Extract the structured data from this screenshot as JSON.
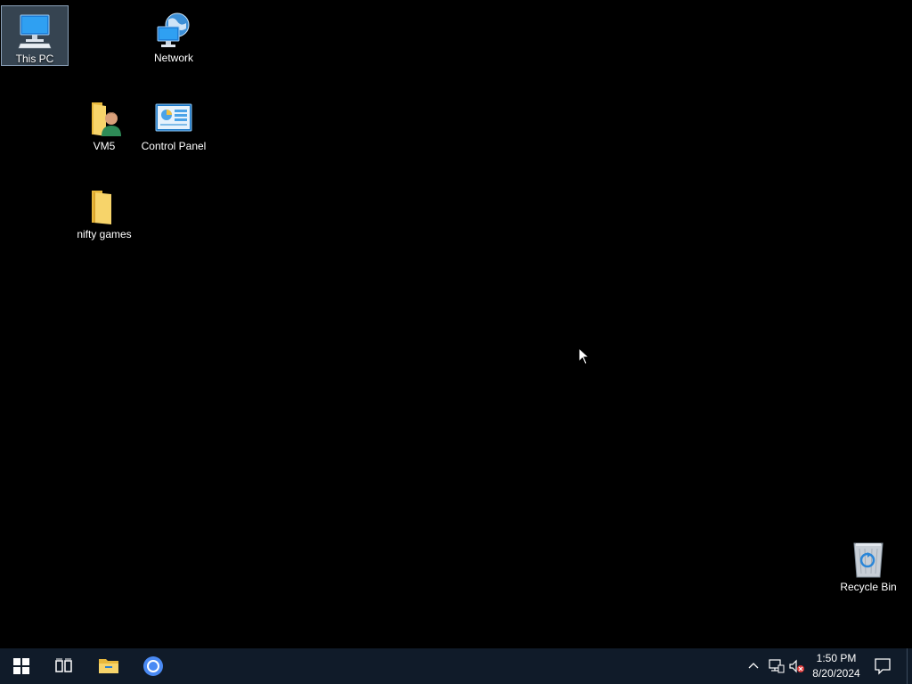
{
  "desktop": {
    "icons": [
      {
        "label": "This PC",
        "icon": "this-pc-icon",
        "selected": true
      },
      {
        "label": "Network",
        "icon": "network-icon",
        "selected": false
      },
      {
        "label": "VM5",
        "icon": "user-folder-icon",
        "selected": false
      },
      {
        "label": "Control Panel",
        "icon": "control-panel-icon",
        "selected": false
      },
      {
        "label": "nifty games",
        "icon": "folder-icon",
        "selected": false
      },
      {
        "label": "Recycle Bin",
        "icon": "recycle-bin-icon",
        "selected": false
      }
    ]
  },
  "taskbar": {
    "start_icon": "windows-logo-icon",
    "task_view_icon": "task-view-icon",
    "pinned": [
      {
        "name": "File Explorer",
        "icon": "folder-icon"
      },
      {
        "name": "Google Chrome",
        "icon": "chrome-icon"
      }
    ],
    "tray": {
      "chevron_icon": "chevron-up-icon",
      "network_icon": "network-wired-icon",
      "volume_icon": "volume-muted-icon"
    },
    "clock": {
      "time": "1:50 PM",
      "date": "8/20/2024"
    },
    "notifications_icon": "action-center-icon"
  },
  "colors": {
    "desktop_background": "#000000",
    "taskbar_background": "#101b29",
    "selection": "#7896b4"
  }
}
